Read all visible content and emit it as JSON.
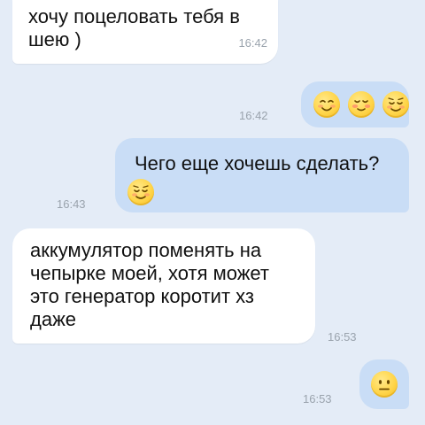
{
  "messages": [
    {
      "direction": "incoming",
      "text": "хочу поцеловать тебя в\nшею )",
      "time": "16:42"
    },
    {
      "direction": "outgoing",
      "emoji": [
        "smiling-face-icon",
        "blushing-face-icon",
        "relieved-face-icon"
      ],
      "time": "16:42"
    },
    {
      "direction": "outgoing",
      "text": "Чего еще хочешь сделать?",
      "emoji": [
        "relieved-face-icon"
      ],
      "time": "16:43"
    },
    {
      "direction": "incoming",
      "text": "аккумулятор поменять на\nчепырке моей, хотя может\nэто генератор коротит хз\nдаже",
      "time": "16:53"
    },
    {
      "direction": "outgoing",
      "emoji": [
        "neutral-face-icon"
      ],
      "time": "16:53"
    }
  ]
}
